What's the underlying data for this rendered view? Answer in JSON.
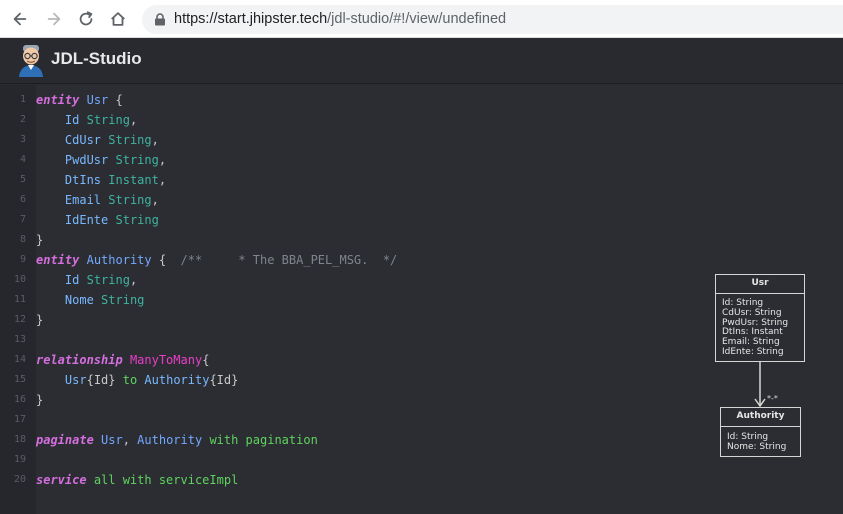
{
  "browser": {
    "url_host": "https://start.jhipster.tech",
    "url_path": "/jdl-studio/#!/view/undefined"
  },
  "app": {
    "title": "JDL-Studio",
    "logo_icon": "jhipster-avatar-icon"
  },
  "editor": {
    "line_numbers": [
      "1",
      "2",
      "3",
      "4",
      "5",
      "6",
      "7",
      "8",
      "9",
      "10",
      "11",
      "12",
      "13",
      "14",
      "15",
      "16",
      "17",
      "18",
      "19",
      "20"
    ],
    "lines": [
      [
        {
          "t": "entity",
          "c": "kw"
        },
        {
          "t": " "
        },
        {
          "t": "Usr",
          "c": "ent"
        },
        {
          "t": " {",
          "c": "pun"
        }
      ],
      [
        {
          "t": "    "
        },
        {
          "t": "Id",
          "c": "fld"
        },
        {
          "t": " "
        },
        {
          "t": "String",
          "c": "typ"
        },
        {
          "t": ",",
          "c": "pun"
        }
      ],
      [
        {
          "t": "    "
        },
        {
          "t": "CdUsr",
          "c": "fld"
        },
        {
          "t": " "
        },
        {
          "t": "String",
          "c": "typ"
        },
        {
          "t": ",",
          "c": "pun"
        }
      ],
      [
        {
          "t": "    "
        },
        {
          "t": "PwdUsr",
          "c": "fld"
        },
        {
          "t": " "
        },
        {
          "t": "String",
          "c": "typ"
        },
        {
          "t": ",",
          "c": "pun"
        }
      ],
      [
        {
          "t": "    "
        },
        {
          "t": "DtIns",
          "c": "fld"
        },
        {
          "t": " "
        },
        {
          "t": "Instant",
          "c": "typ"
        },
        {
          "t": ",",
          "c": "pun"
        }
      ],
      [
        {
          "t": "    "
        },
        {
          "t": "Email",
          "c": "fld"
        },
        {
          "t": " "
        },
        {
          "t": "String",
          "c": "typ"
        },
        {
          "t": ",",
          "c": "pun"
        }
      ],
      [
        {
          "t": "    "
        },
        {
          "t": "IdEnte",
          "c": "fld"
        },
        {
          "t": " "
        },
        {
          "t": "String",
          "c": "typ"
        }
      ],
      [
        {
          "t": "}",
          "c": "pun"
        }
      ],
      [
        {
          "t": "entity",
          "c": "kw"
        },
        {
          "t": " "
        },
        {
          "t": "Authority",
          "c": "ent"
        },
        {
          "t": " {",
          "c": "pun"
        },
        {
          "t": "  /**     * The BBA_PEL_MSG.  */",
          "c": "cmt"
        }
      ],
      [
        {
          "t": "    "
        },
        {
          "t": "Id",
          "c": "fld"
        },
        {
          "t": " "
        },
        {
          "t": "String",
          "c": "typ"
        },
        {
          "t": ",",
          "c": "pun"
        }
      ],
      [
        {
          "t": "    "
        },
        {
          "t": "Nome",
          "c": "fld"
        },
        {
          "t": " "
        },
        {
          "t": "String",
          "c": "typ"
        }
      ],
      [
        {
          "t": "}",
          "c": "pun"
        }
      ],
      [],
      [
        {
          "t": "relationship",
          "c": "kw"
        },
        {
          "t": " "
        },
        {
          "t": "ManyToMany",
          "c": "rel"
        },
        {
          "t": "{",
          "c": "pun"
        }
      ],
      [
        {
          "t": "    "
        },
        {
          "t": "Usr",
          "c": "fld"
        },
        {
          "t": "{Id}",
          "c": "pun"
        },
        {
          "t": " "
        },
        {
          "t": "to",
          "c": "grn"
        },
        {
          "t": " "
        },
        {
          "t": "Authority",
          "c": "fld"
        },
        {
          "t": "{Id}",
          "c": "pun"
        }
      ],
      [
        {
          "t": "}",
          "c": "pun"
        }
      ],
      [],
      [
        {
          "t": "paginate",
          "c": "kw"
        },
        {
          "t": " "
        },
        {
          "t": "Usr",
          "c": "ent"
        },
        {
          "t": ", ",
          "c": "pun"
        },
        {
          "t": "Authority",
          "c": "ent"
        },
        {
          "t": " "
        },
        {
          "t": "with pagination",
          "c": "grn"
        }
      ],
      [],
      [
        {
          "t": "service",
          "c": "kw"
        },
        {
          "t": " "
        },
        {
          "t": "all with serviceImpl",
          "c": "grn"
        }
      ]
    ]
  },
  "diagram": {
    "usr": {
      "title": "Usr",
      "fields": [
        "Id: String",
        "CdUsr: String",
        "PwdUsr: String",
        "DtIns: Instant",
        "Email: String",
        "IdEnte: String"
      ]
    },
    "authority": {
      "title": "Authority",
      "fields": [
        "Id: String",
        "Nome: String"
      ]
    },
    "relation_label": "*-*"
  },
  "colors": {
    "keyword": "#d56ede",
    "entity": "#73a8ff",
    "type": "#3fb3a2",
    "relationship": "#ea3ec9",
    "green": "#5fd35f",
    "background": "#2b2d32"
  }
}
